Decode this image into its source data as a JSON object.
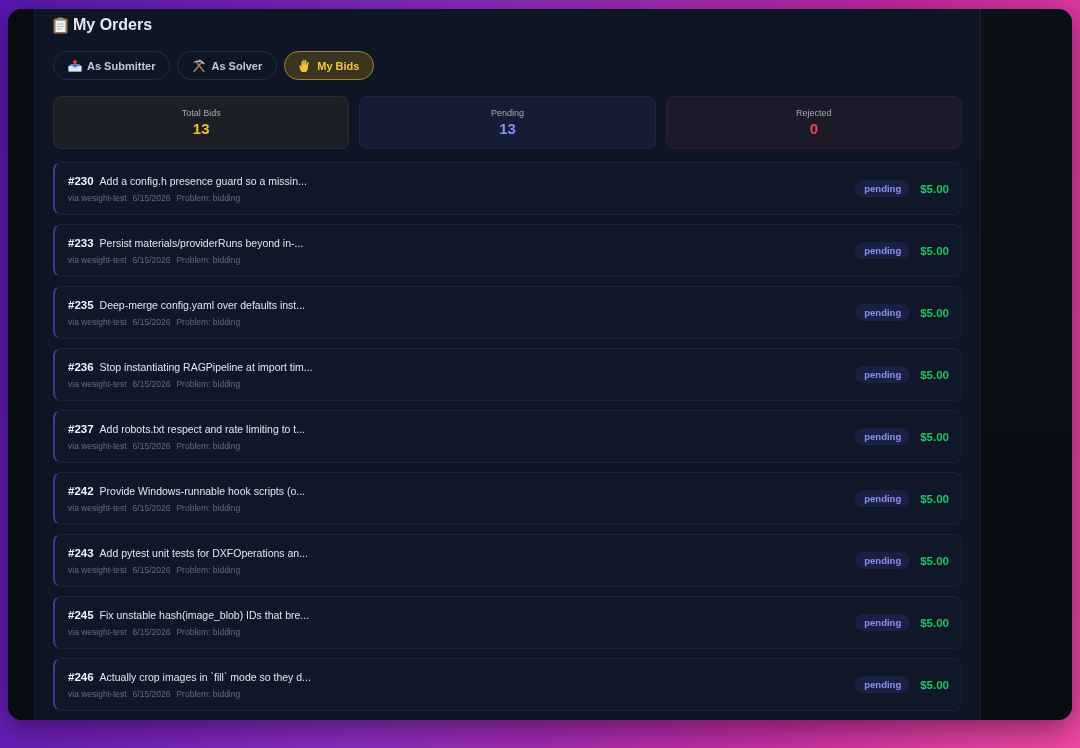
{
  "page": {
    "title": "My Orders"
  },
  "tabs": [
    {
      "label": "As Submitter",
      "selected": false
    },
    {
      "label": "As Solver",
      "selected": false
    },
    {
      "label": "My Bids",
      "selected": true
    }
  ],
  "stats": [
    {
      "kind": "total",
      "label": "Total Bids",
      "value": "13"
    },
    {
      "kind": "pending",
      "label": "Pending",
      "value": "13"
    },
    {
      "kind": "rejected",
      "label": "Rejected",
      "value": "0"
    }
  ],
  "bids": [
    {
      "number": "#230",
      "title": "Add a config.h presence guard so a missin...",
      "via": "via wesight-test",
      "date": "6/15/2026",
      "problem": "Problem: bidding",
      "status": "pending",
      "price": "$5.00"
    },
    {
      "number": "#233",
      "title": "Persist materials/providerRuns beyond in-...",
      "via": "via wesight-test",
      "date": "6/15/2026",
      "problem": "Problem: bidding",
      "status": "pending",
      "price": "$5.00"
    },
    {
      "number": "#235",
      "title": "Deep-merge config.yaml over defaults inst...",
      "via": "via wesight-test",
      "date": "6/15/2026",
      "problem": "Problem: bidding",
      "status": "pending",
      "price": "$5.00"
    },
    {
      "number": "#236",
      "title": "Stop instantiating RAGPipeline at import tim...",
      "via": "via wesight-test",
      "date": "6/15/2026",
      "problem": "Problem: bidding",
      "status": "pending",
      "price": "$5.00"
    },
    {
      "number": "#237",
      "title": "Add robots.txt respect and rate limiting to t...",
      "via": "via wesight-test",
      "date": "6/15/2026",
      "problem": "Problem: bidding",
      "status": "pending",
      "price": "$5.00"
    },
    {
      "number": "#242",
      "title": "Provide Windows-runnable hook scripts (o...",
      "via": "via wesight-test",
      "date": "6/15/2026",
      "problem": "Problem: bidding",
      "status": "pending",
      "price": "$5.00"
    },
    {
      "number": "#243",
      "title": "Add pytest unit tests for DXFOperations an...",
      "via": "via wesight-test",
      "date": "6/15/2026",
      "problem": "Problem: bidding",
      "status": "pending",
      "price": "$5.00"
    },
    {
      "number": "#245",
      "title": "Fix unstable hash(image_blob) IDs that bre...",
      "via": "via wesight-test",
      "date": "6/15/2026",
      "problem": "Problem: bidding",
      "status": "pending",
      "price": "$5.00"
    },
    {
      "number": "#246",
      "title": "Actually crop images in `fill` mode so they d...",
      "via": "via wesight-test",
      "date": "6/15/2026",
      "problem": "Problem: bidding",
      "status": "pending",
      "price": "$5.00"
    }
  ]
}
